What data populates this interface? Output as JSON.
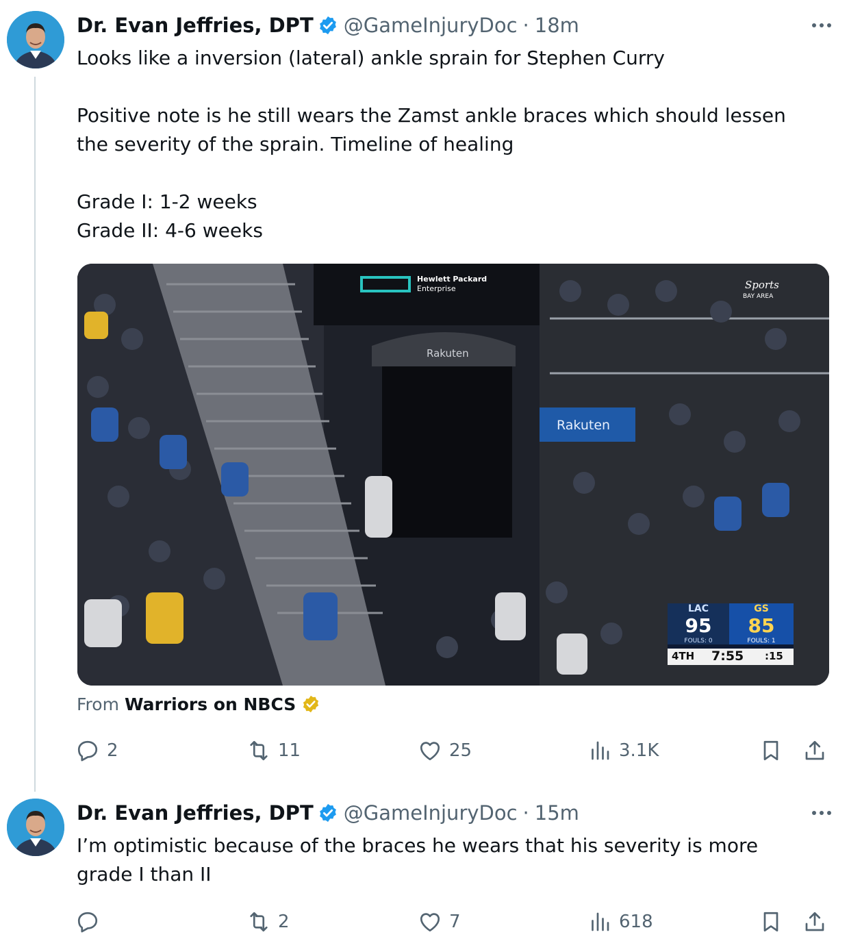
{
  "tweets": [
    {
      "author_name": "Dr. Evan Jeffries, DPT",
      "handle": "@GameInjuryDoc",
      "separator": "·",
      "time": "18m",
      "text_lines": [
        "Looks like a inversion (lateral) ankle sprain for Stephen Curry",
        "",
        "Positive note is he still wears the Zamst ankle braces which should lessen",
        "the severity of the sprain. Timeline of healing",
        "",
        "Grade I: 1-2 weeks",
        "Grade II: 4-6 weeks"
      ],
      "media": {
        "sponsor": "Hewlett Packard Enterprise",
        "tunnel_brand": "Rakuten",
        "banner_brand": "Rakuten",
        "network": "NBC Sports Bay Area",
        "scoreboard": {
          "away_team": "LAC",
          "away_score": "95",
          "away_fouls": "FOULS: 0",
          "home_team": "GS",
          "home_score": "85",
          "home_fouls": "FOULS: 1",
          "period": "4TH",
          "clock": "7:55",
          "shot_clock": ":15"
        }
      },
      "source_prefix": "From",
      "source_name": "Warriors on NBCS",
      "stats": {
        "replies": "2",
        "retweets": "11",
        "likes": "25",
        "views": "3.1K"
      }
    },
    {
      "author_name": "Dr. Evan Jeffries, DPT",
      "handle": "@GameInjuryDoc",
      "separator": "·",
      "time": "15m",
      "text_lines": [
        "I’m optimistic because of the braces he wears that his severity is more",
        "grade I than II"
      ],
      "stats": {
        "replies": "",
        "retweets": "2",
        "likes": "7",
        "views": "618"
      }
    }
  ],
  "colors": {
    "verified": "#1d9bf0",
    "org_badge": "#e2b719",
    "secondary_text": "#536471",
    "avatar_bg": "#2f9bd6"
  },
  "icons": [
    "verified-badge-icon",
    "more-icon",
    "reply-icon",
    "retweet-icon",
    "like-icon",
    "views-icon",
    "bookmark-icon",
    "share-icon"
  ]
}
